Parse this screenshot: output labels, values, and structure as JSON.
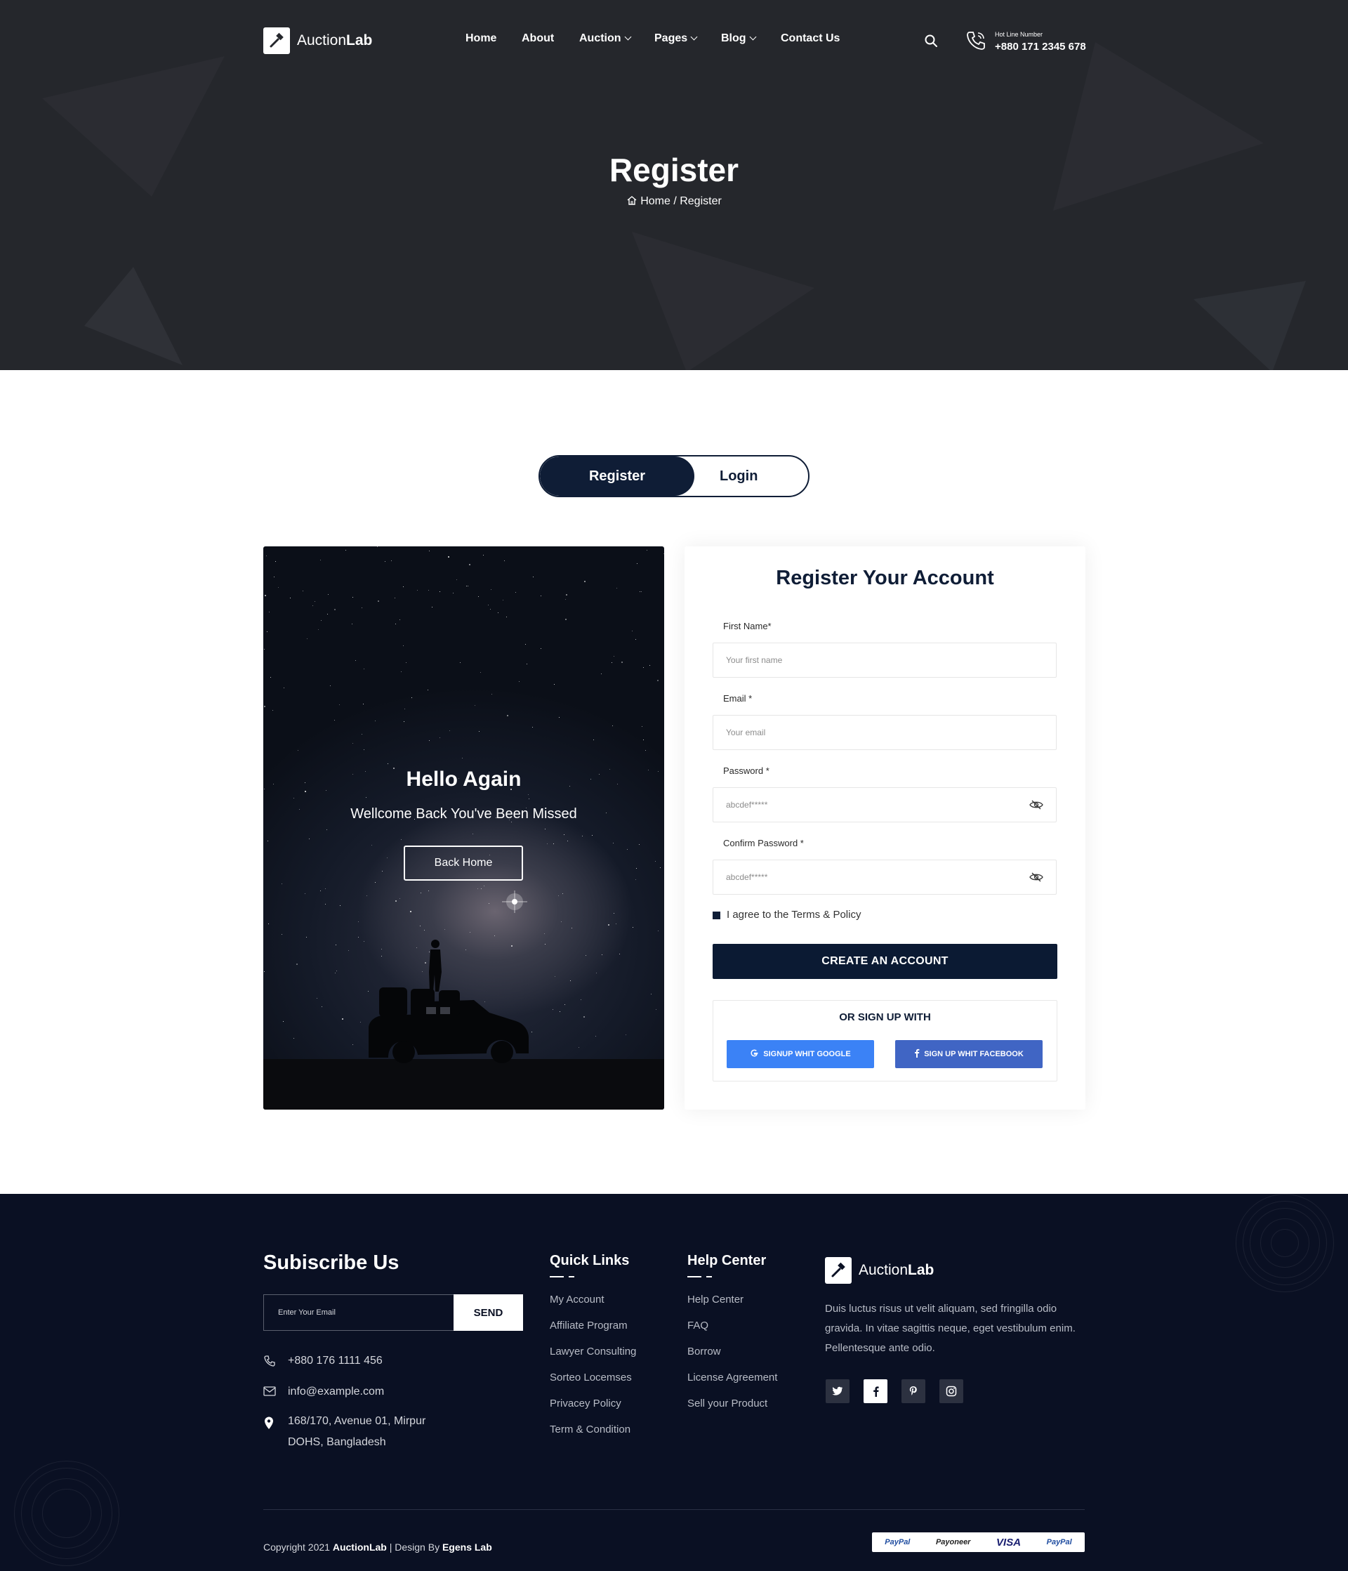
{
  "brand": {
    "name_light": "Auction",
    "name_bold": "Lab"
  },
  "nav": {
    "items": [
      {
        "label": "Home"
      },
      {
        "label": "About"
      },
      {
        "label": "Auction"
      },
      {
        "label": "Pages"
      },
      {
        "label": "Blog"
      },
      {
        "label": "Contact Us"
      }
    ],
    "hotline_label": "Hot Line Number",
    "hotline_number": "+880 171 2345 678"
  },
  "hero": {
    "title": "Register",
    "breadcrumb_home": "Home",
    "breadcrumb_sep": " / ",
    "breadcrumb_current": "Register"
  },
  "toggle": {
    "register": "Register",
    "login": "Login"
  },
  "promo": {
    "heading": "Hello Again",
    "subheading": "Wellcome Back You've Been Missed",
    "button": "Back Home"
  },
  "form": {
    "title": "Register Your Account",
    "first_name_label": "First Name*",
    "first_name_placeholder": "Your first name",
    "email_label": "Email *",
    "email_placeholder": "Your email",
    "password_label": "Password *",
    "password_placeholder": "abcdef*****",
    "confirm_label": "Confirm Password *",
    "confirm_placeholder": "abcdef*****",
    "agree_text": "I agree to the Terms & Policy",
    "submit": "CREATE AN ACCOUNT",
    "or_signup": "OR SIGN UP WITH",
    "google": "SIGNUP WHIT GOOGLE",
    "facebook": "SIGN UP WHIT FACEBOOK",
    "google_color": "#3b82f6",
    "facebook_color": "#4065c4"
  },
  "footer": {
    "subscribe_title": "Subiscribe Us",
    "subscribe_placeholder": "Enter Your Email",
    "send": "SEND",
    "phone": "+880 176 1111 456",
    "email": "info@example.com",
    "address_line1": "168/170, Avenue 01, Mirpur",
    "address_line2": "DOHS, Bangladesh",
    "quick_links_title": "Quick Links",
    "quick_links": [
      "My Account",
      "Affiliate Program",
      "Lawyer Consulting",
      "Sorteo Locemses",
      "Privacey Policy",
      "Term & Condition"
    ],
    "help_title": "Help Center",
    "help_links": [
      "Help Center",
      "FAQ",
      "Borrow",
      "License Agreement",
      "Sell your Product"
    ],
    "about_text": "Duis luctus risus ut velit aliquam, sed fringilla odio gravida. In vitae sagittis neque, eget vestibulum enim. Pellentesque ante odio.",
    "copyright_prefix": "Copyright 2021 ",
    "copyright_brand": "AuctionLab",
    "copyright_mid": " | Design By ",
    "copyright_designer": "Egens Lab",
    "payments": [
      "PayPal",
      "Payoneer",
      "VISA",
      "PayPal"
    ]
  }
}
